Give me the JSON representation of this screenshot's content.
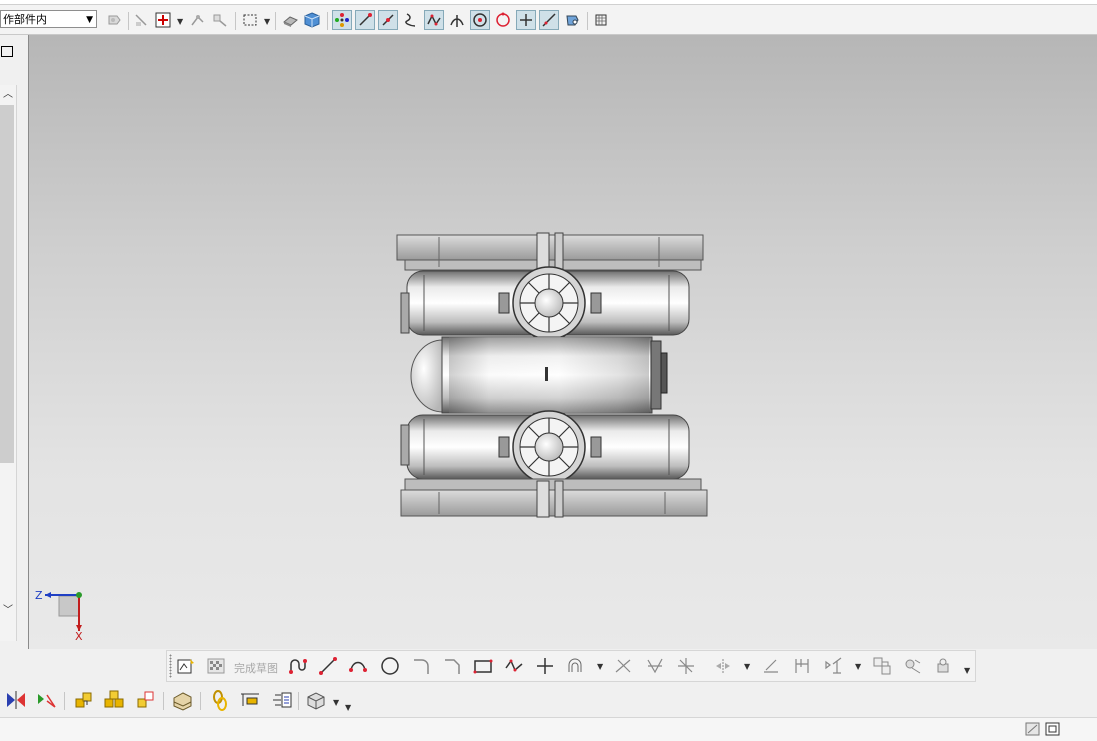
{
  "window": {
    "top_strip": ""
  },
  "top_toolbar": {
    "filter_select": {
      "value": "作部件内"
    },
    "buttons": [
      {
        "id": "select-feature",
        "icon": "select-feature-icon"
      },
      {
        "id": "snap-ref",
        "icon": "snap-ref-icon"
      },
      {
        "id": "add-selection",
        "icon": "add-selection-icon"
      },
      {
        "id": "vertex-select",
        "icon": "vertex-select-icon"
      },
      {
        "id": "move-select",
        "icon": "move-select-icon"
      },
      {
        "id": "rect-select",
        "icon": "rect-select-icon"
      },
      {
        "id": "shaded-view",
        "icon": "shaded-view-icon"
      },
      {
        "id": "solid-view",
        "icon": "solid-view-icon"
      },
      {
        "id": "snap-points",
        "icon": "snap-points-icon",
        "active": true
      },
      {
        "id": "snap-end",
        "icon": "snap-end-icon",
        "active": true
      },
      {
        "id": "snap-mid",
        "icon": "snap-mid-icon",
        "active": true
      },
      {
        "id": "snap-curve",
        "icon": "snap-curve-icon"
      },
      {
        "id": "snap-control",
        "icon": "snap-control-icon",
        "active": true
      },
      {
        "id": "snap-intersect",
        "icon": "snap-intersect-icon"
      },
      {
        "id": "snap-center",
        "icon": "snap-center-icon",
        "active": true
      },
      {
        "id": "snap-quadrant",
        "icon": "snap-quadrant-icon"
      },
      {
        "id": "snap-existing",
        "icon": "snap-existing-icon",
        "active": true
      },
      {
        "id": "snap-on-curve",
        "icon": "snap-on-curve-icon",
        "active": true
      },
      {
        "id": "snap-face",
        "icon": "snap-face-icon"
      },
      {
        "id": "snap-grid",
        "icon": "snap-grid-icon"
      }
    ]
  },
  "triad": {
    "z_label": "Z",
    "x_label": "X"
  },
  "sketch_toolbar": {
    "finish_sketch_label": "完成草图",
    "tools": [
      "sketch-icon",
      "finish-sketch-icon",
      "profile-icon",
      "line-icon",
      "arc-icon",
      "circle-icon",
      "fillet-icon",
      "chamfer-icon",
      "rectangle-icon",
      "polygon-icon",
      "point-icon",
      "offset-icon",
      "trim-icon",
      "extend-icon",
      "make-corner-icon",
      "mirror-icon",
      "constraint-icon",
      "dimension-icon",
      "geometric-constraint-icon",
      "show-constraints-icon",
      "relations-icon",
      "convert-icon"
    ]
  },
  "bottom_toolbar": {
    "tools": [
      "mirror-body-icon",
      "pattern-icon",
      "assembly-icon",
      "components-icon",
      "move-component-icon",
      "wave-icon",
      "constraint-link-icon",
      "explode-icon",
      "section-icon",
      "view-options-icon"
    ]
  },
  "statusbar": {
    "icons": [
      "fullscreen-icon",
      "window-icon"
    ]
  },
  "colors": {
    "viewport_top": "#b6b6b6",
    "viewport_bottom": "#e9e9e9",
    "active_button": "#cfe0e8"
  }
}
